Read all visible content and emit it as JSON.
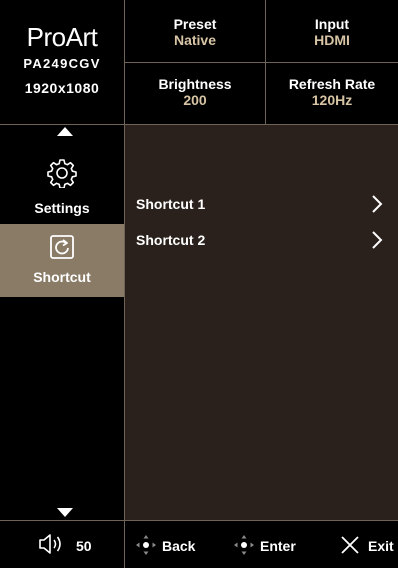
{
  "brand": {
    "logo": "ProArt",
    "model": "PA249CGV",
    "resolution": "1920x1080"
  },
  "status": {
    "preset": {
      "label": "Preset",
      "value": "Native"
    },
    "input": {
      "label": "Input",
      "value": "HDMI"
    },
    "brightness": {
      "label": "Brightness",
      "value": "200"
    },
    "refresh": {
      "label": "Refresh Rate",
      "value": "120Hz"
    }
  },
  "sidebar": {
    "items": [
      {
        "label": "Settings",
        "icon": "gear-icon",
        "selected": false
      },
      {
        "label": "Shortcut",
        "icon": "shortcut-icon",
        "selected": true
      }
    ]
  },
  "content": {
    "rows": [
      {
        "label": "Shortcut 1"
      },
      {
        "label": "Shortcut 2"
      }
    ]
  },
  "footer": {
    "volume": "50",
    "back": "Back",
    "enter": "Enter",
    "exit": "Exit"
  },
  "colors": {
    "accent_value": "#d7c4a5",
    "selected_bg": "#8a7b66",
    "content_bg": "#2a211c",
    "divider": "#6f6357"
  }
}
